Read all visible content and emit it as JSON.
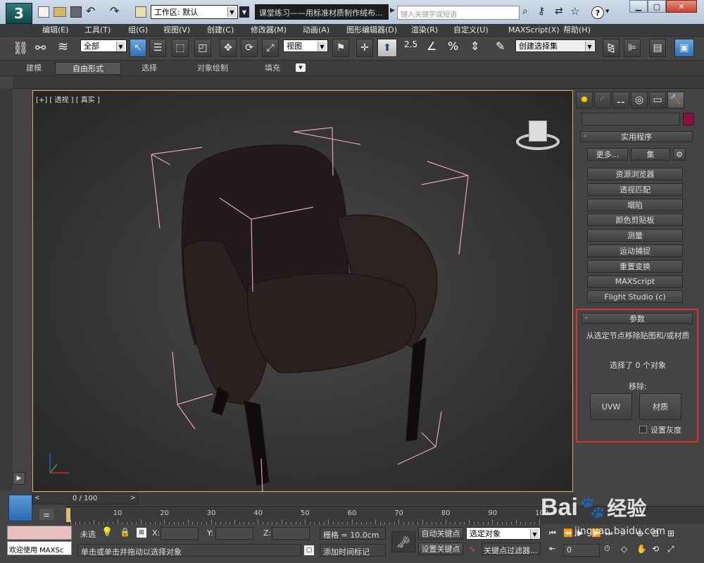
{
  "title_bar": {
    "quick_title": "课堂练习——用标准材质制作绒布...",
    "workspace_label": "工作区: 默认",
    "search_placeholder": "键入关键字或短语",
    "help_label": "?"
  },
  "menu": [
    "编辑(E)",
    "工具(T)",
    "组(G)",
    "视图(V)",
    "创建(C)",
    "修改器(M)",
    "动画(A)",
    "图形编辑器(D)",
    "渲染(R)",
    "自定义(U)",
    "MAXScript(X)",
    "帮助(H)"
  ],
  "toolbar": {
    "filter_value": "全部",
    "coord_value": "视图",
    "snap_value": "2.5",
    "angle_label": "%",
    "selection_set_value": "创建选择集"
  },
  "ribbon_tabs": [
    "建模",
    "自由形式",
    "选择",
    "对象绘制",
    "填充"
  ],
  "viewport": {
    "label": "[+] [ 透视 ] [ 真实 ]"
  },
  "command_panel": {
    "rollout_utilities_title": "实用程序",
    "more_button": "更多...",
    "sets_button": "集",
    "utilities": [
      "资源浏览器",
      "透视匹配",
      "塌陷",
      "颜色剪贴板",
      "测量",
      "运动捕捉",
      "重置变换",
      "MAXScript",
      "Flight Studio (c)"
    ],
    "params_title": "参数",
    "params_desc": "从选定节点移除贴图和/或材质",
    "params_selected": "选择了 0 个对象",
    "params_remove_label": "移除:",
    "uvw_button": "UVW",
    "material_button": "材质",
    "gray_checkbox_label": "设置灰度",
    "highlight_color": "#e03030"
  },
  "timeline": {
    "frame_label": "0 / 100",
    "ticks": [
      "10",
      "20",
      "30",
      "40",
      "50",
      "60",
      "70",
      "80",
      "90",
      "100"
    ]
  },
  "status": {
    "script_label": "欢迎使用 MAXSc",
    "selection_text": "未选",
    "x_label": "X:",
    "y_label": "Y:",
    "z_label": "Z:",
    "grid_text": "栅格 = 10.0cm",
    "prompt_text": "单击或单击并拖动以选择对象",
    "add_marker": "添加时间标记",
    "auto_key": "自动关键点",
    "set_key": "设置关键点",
    "key_mode_value": "选定对象",
    "key_filter": "关键点过滤器...",
    "frame_value": "0"
  },
  "watermark": {
    "brand": "Bai",
    "brand2": "经验",
    "url": "jingyan.baidu.com"
  },
  "colors": {
    "accent": "#4a90d0",
    "viewport_bg": "#333",
    "bbox": "#e8a0c0"
  }
}
